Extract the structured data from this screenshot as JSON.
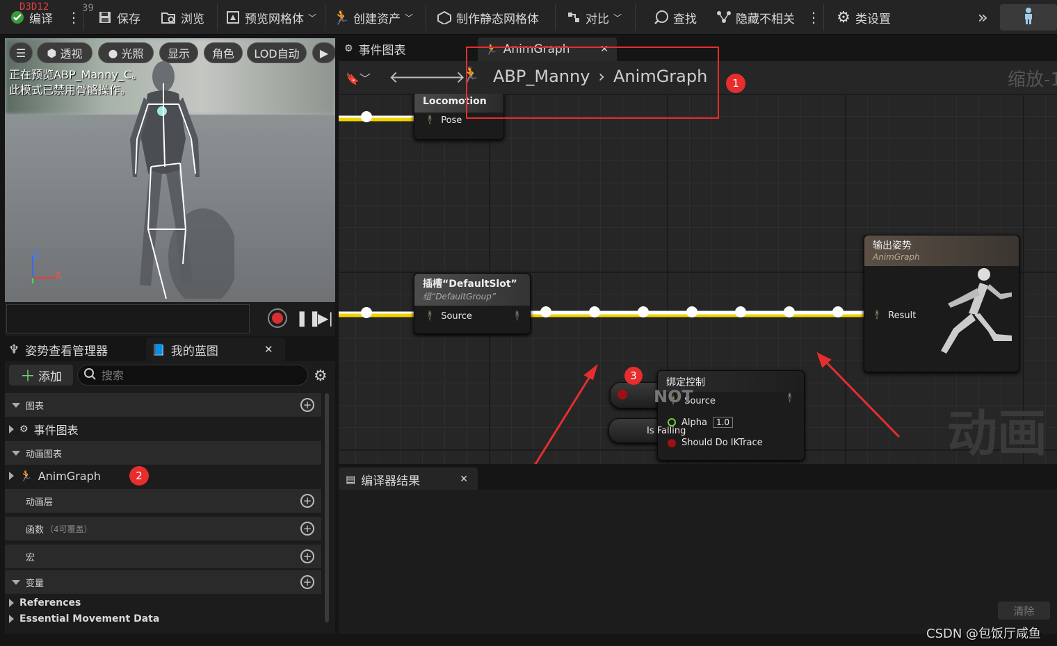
{
  "toolbar": {
    "stats_red": "D3D12",
    "stats_gray": "39",
    "compile": "编译",
    "save": "保存",
    "browse": "浏览",
    "preview_mesh": "预览网格体",
    "create_asset": "创建资产",
    "make_static_mesh": "制作静态网格体",
    "diff": "对比",
    "find": "查找",
    "hide_unrelated": "隐藏不相关",
    "class_settings": "类设置"
  },
  "viewport": {
    "buttons": [
      "透视",
      "光照",
      "显示",
      "角色",
      "LOD自动"
    ],
    "message_line1": "正在预览ABP_Manny_C。",
    "message_line2": "此模式已禁用骨骼操作。",
    "axis_z": "Z",
    "axis_x": "X"
  },
  "left_tabs": {
    "pose_watch": "姿势查看管理器",
    "my_blueprint": "我的蓝图"
  },
  "my_blueprint": {
    "add": "添加",
    "search_placeholder": "搜索",
    "graphs_category": "图表",
    "event_graph": "事件图表",
    "anim_graphs_category": "动画图表",
    "anim_graph": "AnimGraph",
    "anim_layers": "动画层",
    "functions": "函数",
    "functions_note": "（4可覆盖）",
    "macros": "宏",
    "variables": "变量",
    "var_groups": [
      "References",
      "Essential Movement Data"
    ]
  },
  "editor_tabs": {
    "event_graph": "事件图表",
    "anim_graph": "AnimGraph"
  },
  "breadcrumb": {
    "root": "ABP_Manny",
    "child": "AnimGraph",
    "zoom": "缩放-1"
  },
  "nodes": {
    "locomotion": {
      "title": "Locomotion",
      "pin": "Pose"
    },
    "slot": {
      "title": "插槽“DefaultSlot”",
      "subtitle": "组“DefaultGroup”",
      "pin": "Source"
    },
    "output": {
      "title": "输出姿势",
      "subtitle": "AnimGraph",
      "pin": "Result"
    },
    "control_rig": {
      "title": "绑定控制",
      "pins": [
        "Source",
        "Alpha",
        "Should Do IKTrace"
      ],
      "alpha_value": "1.0"
    },
    "not": {
      "title": "NOT"
    },
    "is_falling": {
      "title": "Is Falling"
    }
  },
  "graph_watermark": "动画",
  "compiler": {
    "tab": "编译器结果",
    "clear": "清除"
  },
  "annotations": [
    "1",
    "2",
    "3"
  ],
  "footer_credit": "CSDN @包饭厅咸鱼",
  "colors": {
    "annotation_red": "#e62e2e",
    "exec_wire": "#f0d400",
    "pose_wire": "#ffffff"
  }
}
